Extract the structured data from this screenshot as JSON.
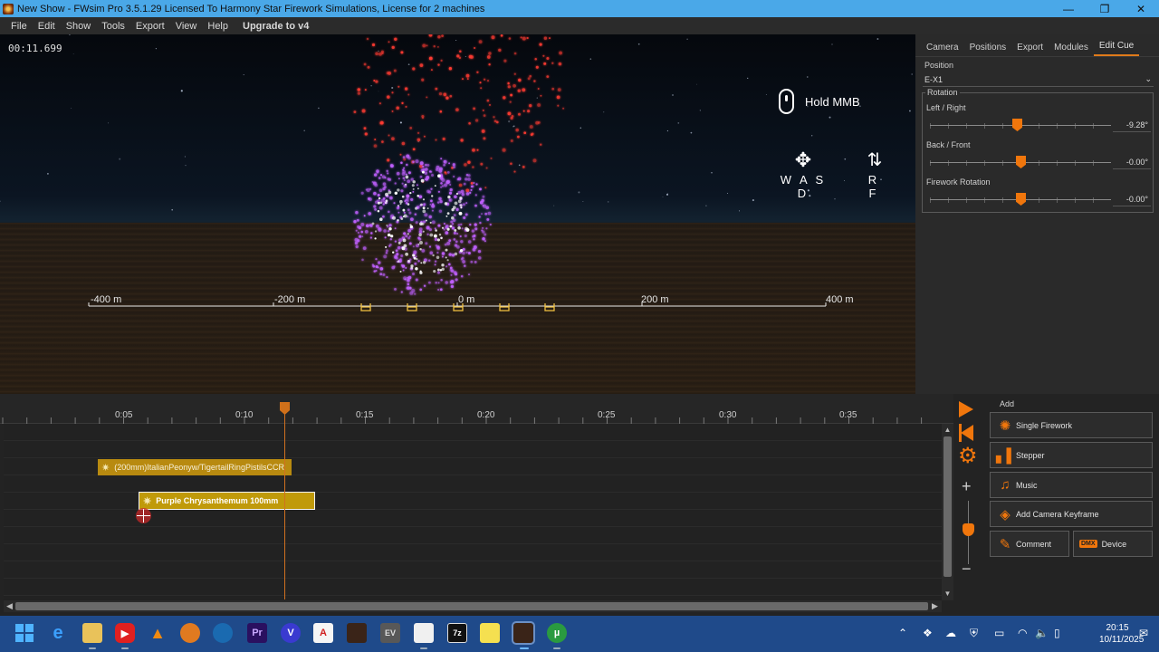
{
  "window": {
    "title": "New Show - FWsim Pro 3.5.1.29 Licensed To Harmony Star Firework Simulations, License for 2 machines",
    "minimize": "—",
    "maximize": "❐",
    "close": "✕"
  },
  "menu": {
    "items": [
      "File",
      "Edit",
      "Show",
      "Tools",
      "Export",
      "View",
      "Help"
    ],
    "upgrade": "Upgrade to v4"
  },
  "viewport": {
    "timecode": "00:11.699",
    "hint_mmb": "Hold MMB",
    "hint_wasd": "W A S D",
    "hint_wasd_arrows": "✥",
    "hint_rf": "R F",
    "hint_rf_arrows": "⇅",
    "scale_labels": [
      "-400 m",
      "-200 m",
      "0 m",
      "200 m",
      "400 m"
    ],
    "colors": {
      "red_burst": "#ff3b30",
      "purple_burst": "#c060ff",
      "position_marker": "#f0c040"
    }
  },
  "right_panel": {
    "tabs": [
      "Camera",
      "Positions",
      "Export",
      "Modules",
      "Edit Cue"
    ],
    "active_tab": "Edit Cue",
    "position_label": "Position",
    "position_value": "E-X1",
    "rotation_title": "Rotation",
    "sliders": [
      {
        "label": "Left / Right",
        "value": "-9.28°",
        "level": 0.48
      },
      {
        "label": "Back / Front",
        "value": "-0.00°",
        "level": 0.5
      },
      {
        "label": "Firework Rotation",
        "value": "-0.00°",
        "level": 0.5
      }
    ]
  },
  "timeline": {
    "ruler_labels": [
      "0:05",
      "0:10",
      "0:15",
      "0:20",
      "0:25",
      "0:30",
      "0:35"
    ],
    "cues": [
      {
        "label": "(200mm)ItalianPeonyw/TigertailRingPistilsCCR",
        "icon": "sparkle-icon"
      },
      {
        "label": "Purple Chrysanthemum 100mm",
        "icon": "sparkle-icon"
      }
    ]
  },
  "add_panel": {
    "title": "Add",
    "buttons": {
      "single_firework": "Single Firework",
      "stepper": "Stepper",
      "music": "Music",
      "camera_keyframe": "Add Camera Keyframe",
      "comment": "Comment",
      "device": "Device",
      "dmx_badge": "DMX"
    },
    "accent": "#f0760c"
  },
  "taskbar": {
    "time": "20:15",
    "date": "10/11/2025"
  }
}
